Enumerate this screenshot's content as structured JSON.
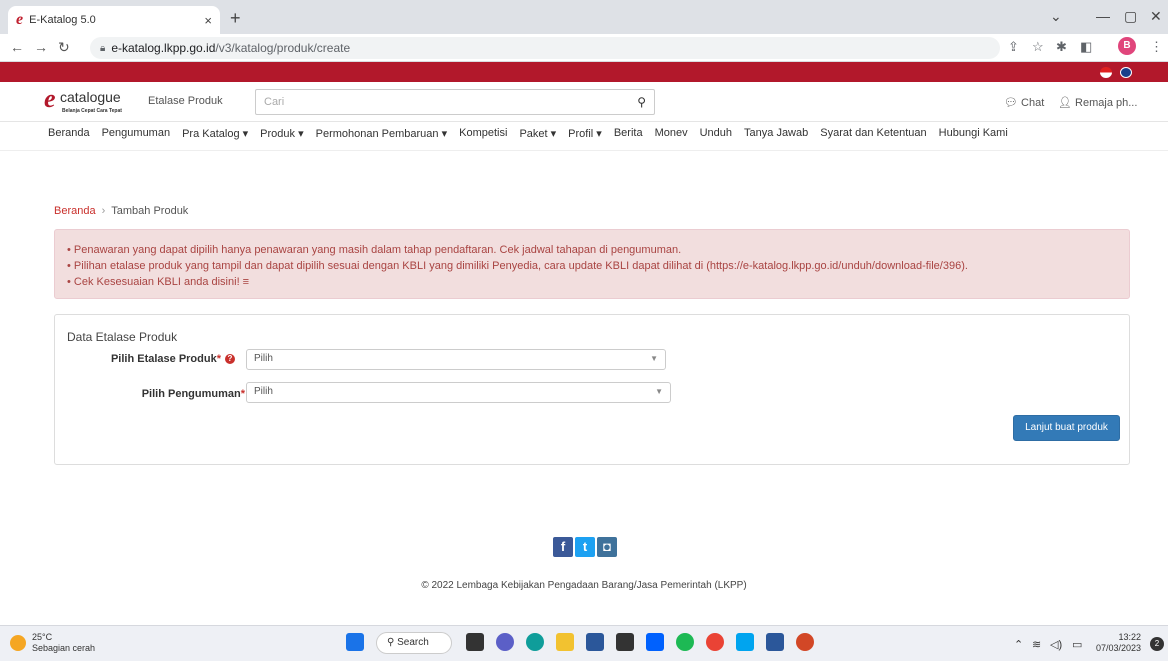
{
  "browser": {
    "tab_title": "E-Katalog 5.0",
    "tab_close": "×",
    "new_tab": "+",
    "url_host": "e-katalog.lkpp.go.id",
    "url_path": "/v3/katalog/produk/create",
    "profile_initial": "B"
  },
  "site": {
    "logo_word": "catalogue",
    "logo_tag": "Belanja Cepat Cara Tepat",
    "etalase_button": "Etalase Produk",
    "search_placeholder": "Cari",
    "chat_label": "Chat",
    "user_label": "Remaja ph...",
    "menu": [
      {
        "label": "Beranda",
        "dropdown": false
      },
      {
        "label": "Pengumuman",
        "dropdown": false
      },
      {
        "label": "Pra Katalog",
        "dropdown": true
      },
      {
        "label": "Produk",
        "dropdown": true
      },
      {
        "label": "Permohonan Pembaruan",
        "dropdown": true
      },
      {
        "label": "Kompetisi",
        "dropdown": false
      },
      {
        "label": "Paket",
        "dropdown": true
      },
      {
        "label": "Profil",
        "dropdown": true
      },
      {
        "label": "Berita",
        "dropdown": false
      },
      {
        "label": "Monev",
        "dropdown": false
      },
      {
        "label": "Unduh",
        "dropdown": false
      },
      {
        "label": "Tanya Jawab",
        "dropdown": false
      },
      {
        "label": "Syarat dan Ketentuan",
        "dropdown": false
      },
      {
        "label": "Hubungi Kami",
        "dropdown": false
      }
    ]
  },
  "breadcrumb": {
    "home": "Beranda",
    "separator": "›",
    "current": "Tambah Produk"
  },
  "alert": {
    "lines": [
      "• Penawaran yang dapat dipilih hanya penawaran yang masih dalam tahap pendaftaran. Cek jadwal tahapan di pengumuman.",
      "• Pilihan etalase produk yang tampil dan dapat dipilih sesuai dengan KBLI yang dimiliki Penyedia, cara update KBLI dapat dilihat di (https://e-katalog.lkpp.go.id/unduh/download-file/396).",
      "• Cek Kesesuaian KBLI anda disini! ≡"
    ]
  },
  "form": {
    "title": "Data Etalase Produk",
    "etalase_label": "Pilih Etalase Produk",
    "pengumuman_label": "Pilih Pengumuman",
    "required_mark": "*",
    "etalase_value": "Pilih",
    "pengumuman_value": "Pilih",
    "submit_label": "Lanjut buat produk"
  },
  "footer": {
    "copyright": "© 2022 Lembaga Kebijakan Pengadaan Barang/Jasa Pemerintah (LKPP)"
  },
  "taskbar": {
    "temperature": "25°C",
    "weather": "Sebagian cerah",
    "search_label": "Search",
    "time": "13:22",
    "date": "07/03/2023",
    "notifications": "2"
  },
  "colors": {
    "brand_red": "#b2182b",
    "primary_blue": "#337ab7",
    "alert_bg": "#f2dede",
    "alert_text": "#a94442"
  }
}
